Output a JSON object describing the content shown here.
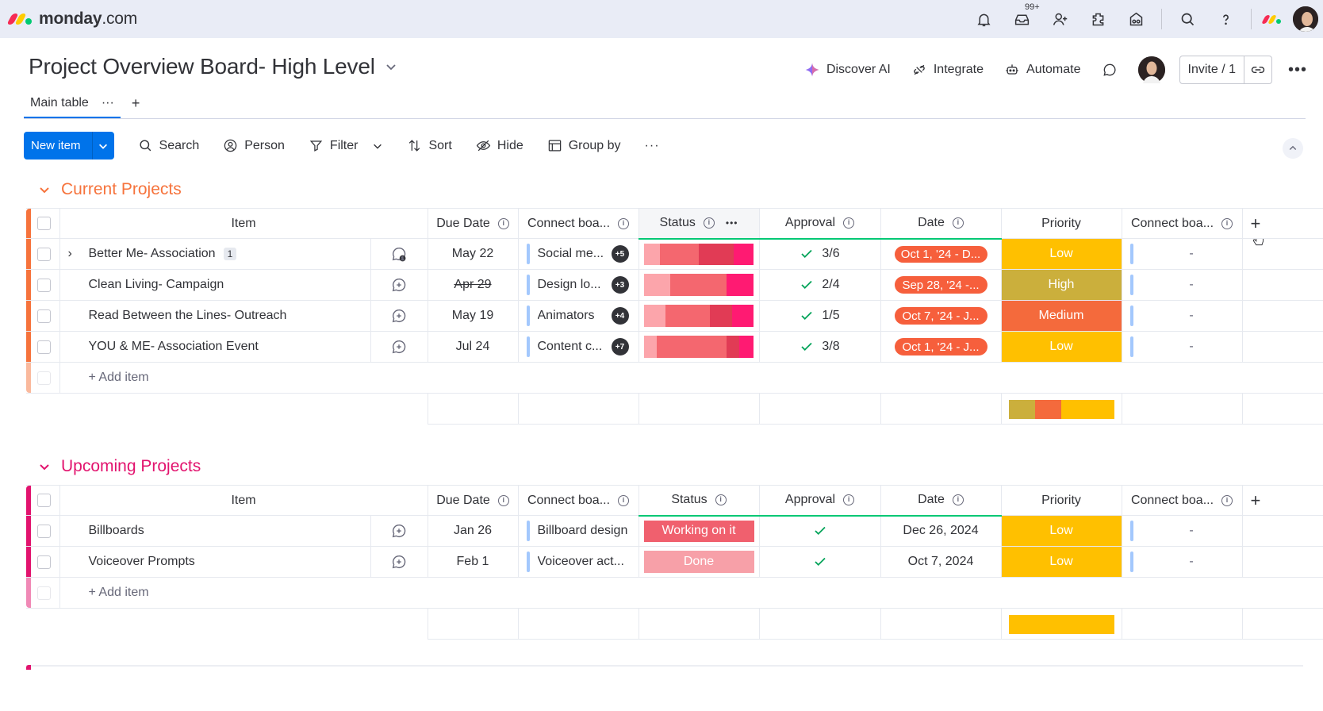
{
  "topbar": {
    "logo_brand": "monday",
    "logo_suffix": ".com",
    "inbox_badge": "99+",
    "icons": [
      "bell-icon",
      "inbox-icon",
      "invite-members-icon",
      "apps-icon",
      "marketplace-icon",
      "search-icon",
      "help-icon"
    ]
  },
  "header": {
    "board_title": "Project Overview Board- High Level",
    "actions": {
      "discover_ai": "Discover AI",
      "integrate": "Integrate",
      "automate": "Automate"
    },
    "invite_label": "Invite / 1"
  },
  "tabs": {
    "main_table": "Main table",
    "more": "···",
    "add": "+"
  },
  "toolbar": {
    "new_item": "New item",
    "search": "Search",
    "person": "Person",
    "filter": "Filter",
    "sort": "Sort",
    "hide": "Hide",
    "group_by": "Group by",
    "more": "···"
  },
  "columns": {
    "item": "Item",
    "due_date": "Due Date",
    "connect_boards": "Connect boa...",
    "status": "Status",
    "approval": "Approval",
    "date": "Date",
    "priority": "Priority",
    "connect_boards_2": "Connect boa..."
  },
  "colors": {
    "orange_group": "#f6733c",
    "pink_group": "#e2136e",
    "priority_low": "#ffc000",
    "priority_high": "#cbaf3c",
    "priority_medium": "#f46a3c",
    "date_pill": "#f65f3c",
    "working_on_it": "#f0606e",
    "done": "#f7a0a8"
  },
  "groups": {
    "current": {
      "title": "Current Projects",
      "add_item": "+ Add item",
      "rows": [
        {
          "name": "Better Me- Association",
          "subitems": "1",
          "due": "May 22",
          "due_strike": false,
          "connect": "Social me...",
          "connect_more": "+5",
          "approval": "3/6",
          "date": "Oct 1, '24 - D...",
          "priority": "Low",
          "connect2": "-",
          "status_mix": [
            0.15,
            0.35,
            0.32,
            0.18
          ]
        },
        {
          "name": "Clean Living- Campaign",
          "subitems": "",
          "due": "Apr 29",
          "due_strike": true,
          "connect": "Design lo...",
          "connect_more": "+3",
          "approval": "2/4",
          "date": "Sep 28, '24 -...",
          "priority": "High",
          "connect2": "-",
          "status_mix": [
            0.24,
            0.51,
            0,
            0.25
          ]
        },
        {
          "name": "Read Between the Lines- Outreach",
          "subitems": "",
          "due": "May 19",
          "due_strike": false,
          "connect": "Animators",
          "connect_more": "+4",
          "approval": "1/5",
          "date": "Oct 7, '24 - J...",
          "priority": "Medium",
          "connect2": "-",
          "status_mix": [
            0.2,
            0.4,
            0.2,
            0.2
          ]
        },
        {
          "name": "YOU & ME- Association Event",
          "subitems": "",
          "due": "Jul 24",
          "due_strike": false,
          "connect": "Content c...",
          "connect_more": "+7",
          "approval": "3/8",
          "date": "Oct 1, '24 - J...",
          "priority": "Low",
          "connect2": "-",
          "status_mix": [
            0.12,
            0.63,
            0.12,
            0.13
          ]
        }
      ],
      "priority_summary": [
        0.25,
        0.25,
        0.5
      ]
    },
    "upcoming": {
      "title": "Upcoming Projects",
      "add_item": "+ Add item",
      "rows": [
        {
          "name": "Billboards",
          "due": "Jan 26",
          "connect": "Billboard design",
          "status": "Working on it",
          "date": "Dec 26, 2024",
          "priority": "Low",
          "connect2": "-"
        },
        {
          "name": "Voiceover Prompts",
          "due": "Feb 1",
          "connect": "Voiceover act...",
          "status": "Done",
          "date": "Oct 7, 2024",
          "priority": "Low",
          "connect2": "-"
        }
      ],
      "priority_summary": [
        1.0
      ]
    }
  }
}
